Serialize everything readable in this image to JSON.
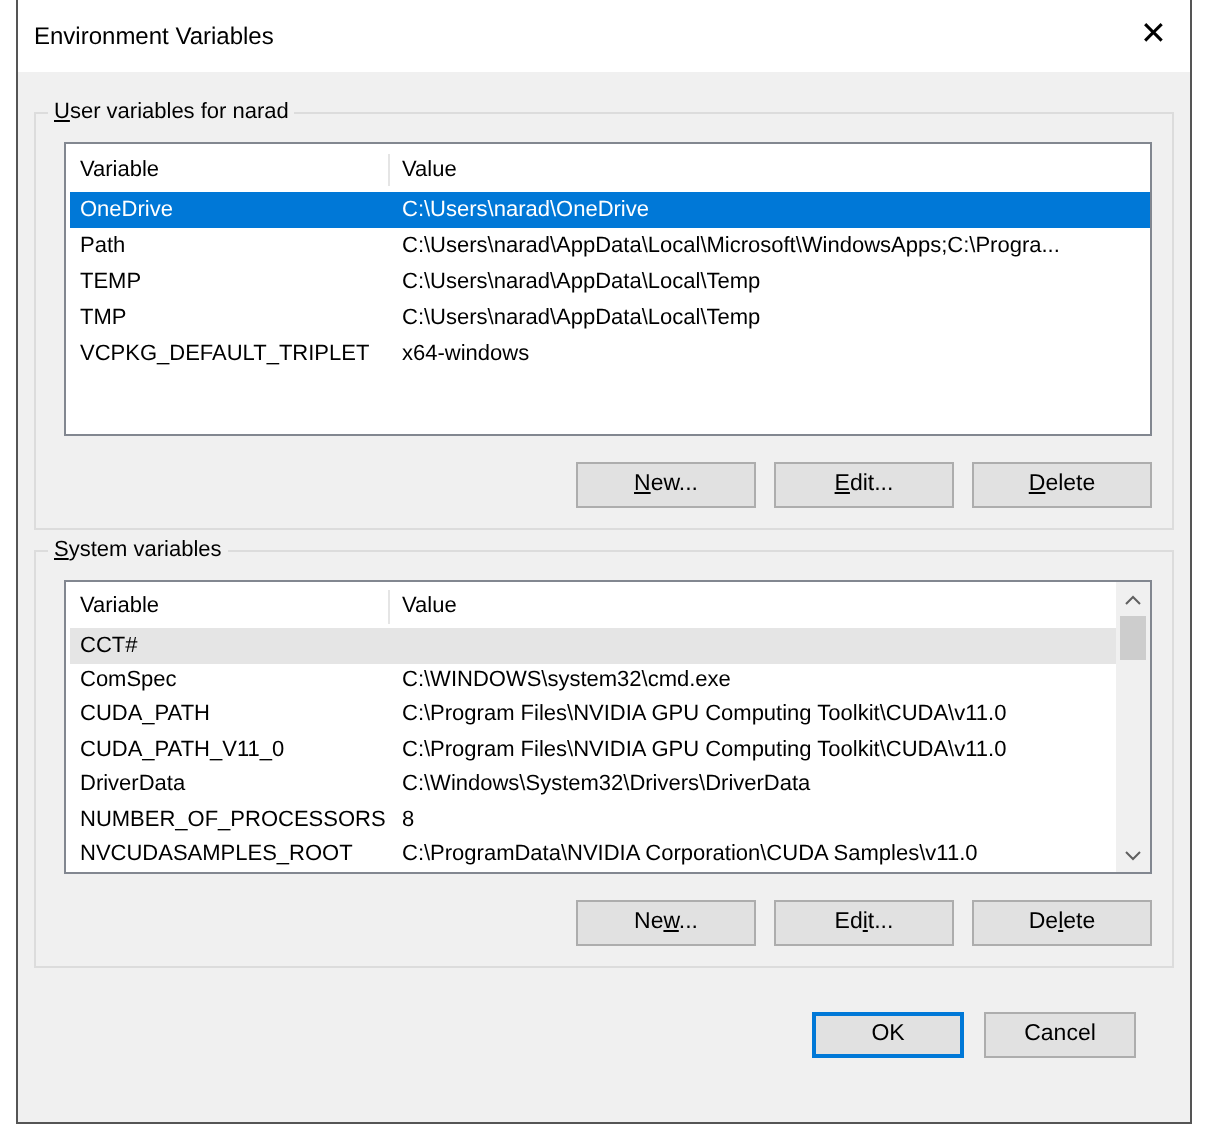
{
  "window": {
    "title": "Environment Variables",
    "close": "✕"
  },
  "groups": [
    {
      "title": {
        "mnemonic": "U",
        "after": "ser variables for narad"
      },
      "focused": true,
      "scrollbar": false,
      "columns": [
        "Variable",
        "Value"
      ],
      "rows": [
        {
          "variable": "OneDrive",
          "value": "C:\\Users\\narad\\OneDrive",
          "selected": true
        },
        {
          "variable": "Path",
          "value": "C:\\Users\\narad\\AppData\\Local\\Microsoft\\WindowsApps;C:\\Progra...",
          "selected": false
        },
        {
          "variable": "TEMP",
          "value": "C:\\Users\\narad\\AppData\\Local\\Temp",
          "selected": false
        },
        {
          "variable": "TMP",
          "value": "C:\\Users\\narad\\AppData\\Local\\Temp",
          "selected": false
        },
        {
          "variable": "VCPKG_DEFAULT_TRIPLET",
          "value": "x64-windows",
          "selected": false
        }
      ],
      "buttons": [
        {
          "mnemonic": "N",
          "after": "ew..."
        },
        {
          "mnemonic": "E",
          "after": "dit..."
        },
        {
          "mnemonic": "D",
          "after": "elete"
        }
      ]
    },
    {
      "title": {
        "mnemonic": "S",
        "after": "ystem variables"
      },
      "focused": false,
      "scrollbar": true,
      "columns": [
        "Variable",
        "Value"
      ],
      "rows": [
        {
          "variable": "CCT#",
          "selected": true
        },
        {
          "variable": "ComSpec",
          "value": "C:\\WINDOWS\\system32\\cmd.exe",
          "selected": false
        },
        {
          "variable": "CUDA_PATH",
          "value": "C:\\Program Files\\NVIDIA GPU Computing Toolkit\\CUDA\\v11.0",
          "selected": false
        },
        {
          "variable": "CUDA_PATH_V11_0",
          "value": "C:\\Program Files\\NVIDIA GPU Computing Toolkit\\CUDA\\v11.0",
          "selected": false
        },
        {
          "variable": "DriverData",
          "value": "C:\\Windows\\System32\\Drivers\\DriverData",
          "selected": false
        },
        {
          "variable": "NUMBER_OF_PROCESSORS",
          "value": "8",
          "selected": false
        },
        {
          "variable": "NVCUDASAMPLES_ROOT",
          "value": "C:\\ProgramData\\NVIDIA Corporation\\CUDA Samples\\v11.0",
          "selected": false
        }
      ],
      "buttons": [
        {
          "before": "Ne",
          "mnemonic": "w",
          "after": "..."
        },
        {
          "before": "Ed",
          "mnemonic": "i",
          "after": "t..."
        },
        {
          "before": "De",
          "mnemonic": "l",
          "after": "ete"
        }
      ]
    }
  ],
  "footer": [
    {
      "label": "OK",
      "default": true
    },
    {
      "label": "Cancel",
      "default": false
    }
  ]
}
